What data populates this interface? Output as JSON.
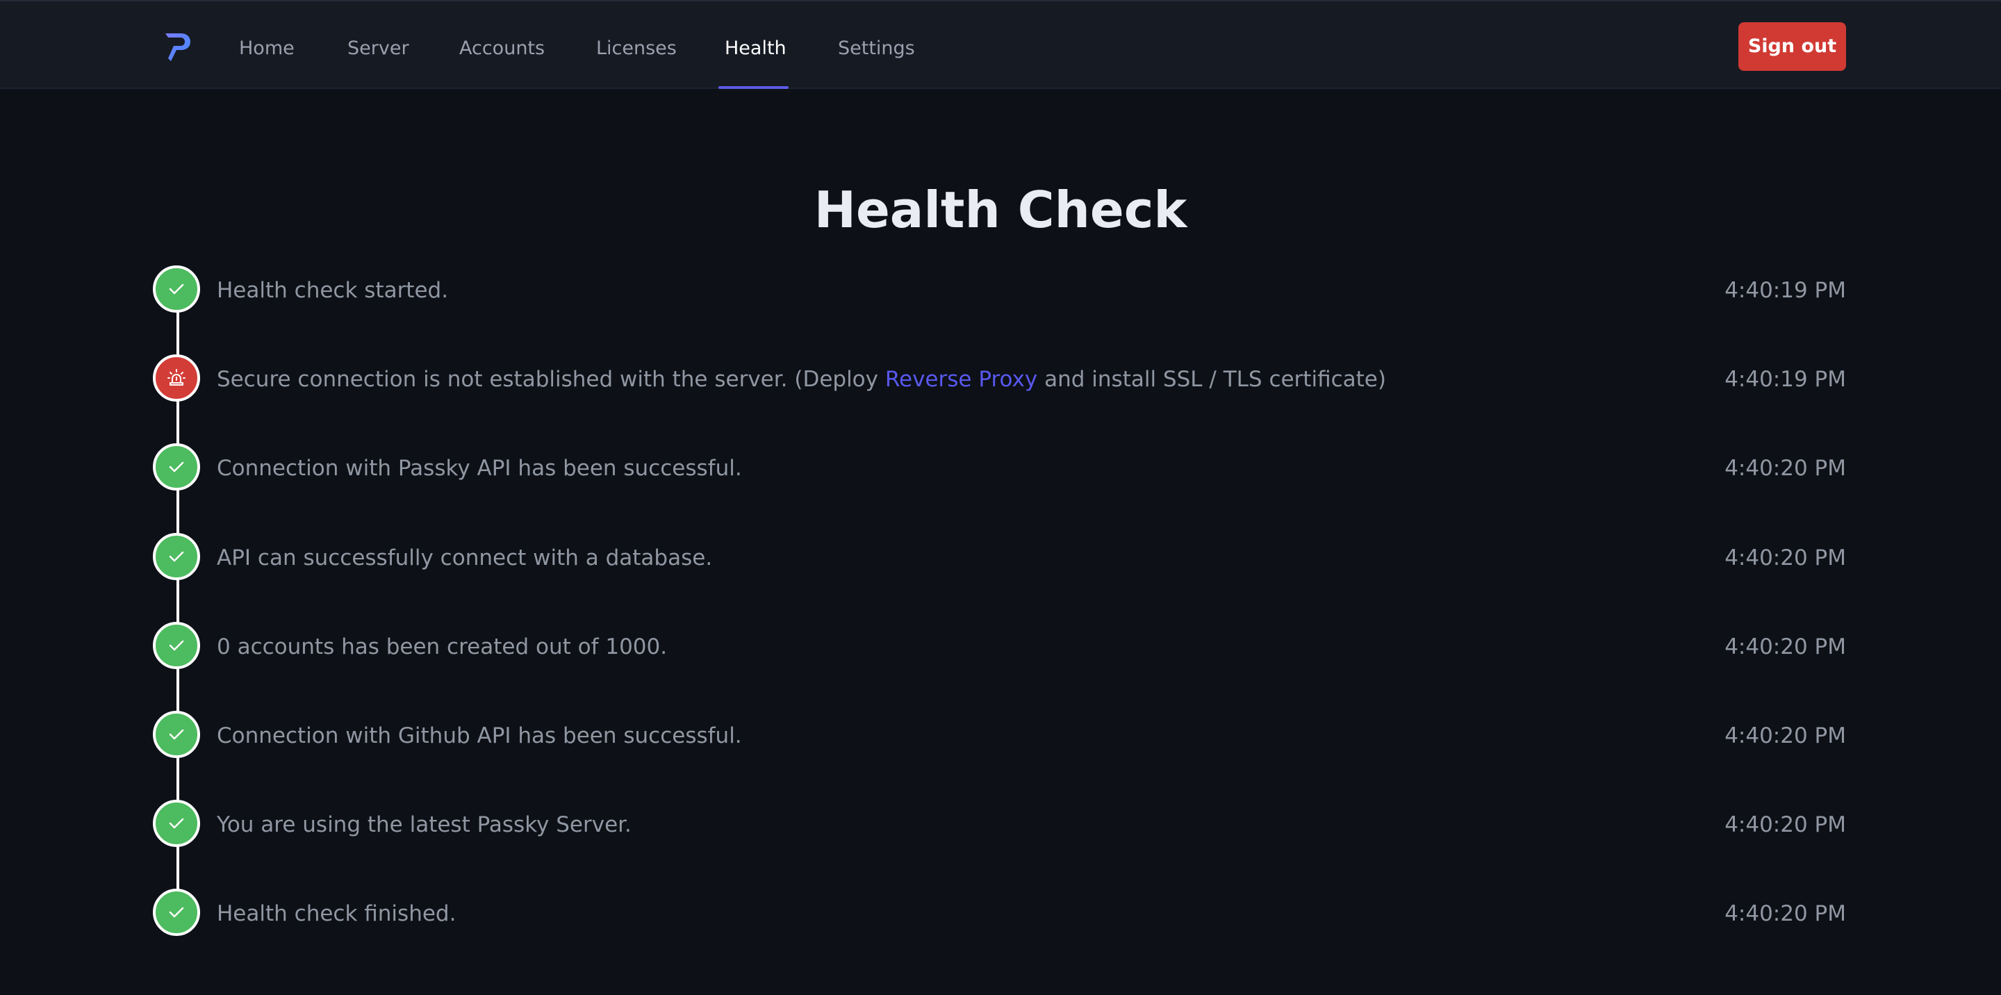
{
  "nav": {
    "links": [
      {
        "label": "Home"
      },
      {
        "label": "Server"
      },
      {
        "label": "Accounts"
      },
      {
        "label": "Licenses"
      },
      {
        "label": "Health",
        "active": true
      },
      {
        "label": "Settings"
      }
    ],
    "signout_label": "Sign out",
    "logo_icon": "passky-logo-icon",
    "accent_color": "#5c5ce6",
    "signout_color": "#d03a33"
  },
  "page": {
    "title": "Health Check"
  },
  "steps": [
    {
      "status": "ok",
      "icon": "check-icon",
      "text": "Health check started.",
      "time": "4:40:19 PM"
    },
    {
      "status": "error",
      "icon": "alarm-siren-icon",
      "text_before": "Secure connection is not established with the server. (Deploy ",
      "link": "Reverse Proxy",
      "text_after": " and install SSL / TLS certificate)",
      "time": "4:40:19 PM"
    },
    {
      "status": "ok",
      "icon": "check-icon",
      "text": "Connection with Passky API has been successful.",
      "time": "4:40:20 PM"
    },
    {
      "status": "ok",
      "icon": "check-icon",
      "text": "API can successfully connect with a database.",
      "time": "4:40:20 PM"
    },
    {
      "status": "ok",
      "icon": "check-icon",
      "text": "0 accounts has been created out of 1000.",
      "time": "4:40:20 PM"
    },
    {
      "status": "ok",
      "icon": "check-icon",
      "text": "Connection with Github API has been successful.",
      "time": "4:40:20 PM"
    },
    {
      "status": "ok",
      "icon": "check-icon",
      "text": "You are using the latest Passky Server.",
      "time": "4:40:20 PM"
    },
    {
      "status": "ok",
      "icon": "check-icon",
      "text": "Health check finished.",
      "time": "4:40:20 PM"
    }
  ],
  "colors": {
    "success": "#4dbb5f",
    "error": "#d33d37",
    "link": "#5858ee"
  }
}
